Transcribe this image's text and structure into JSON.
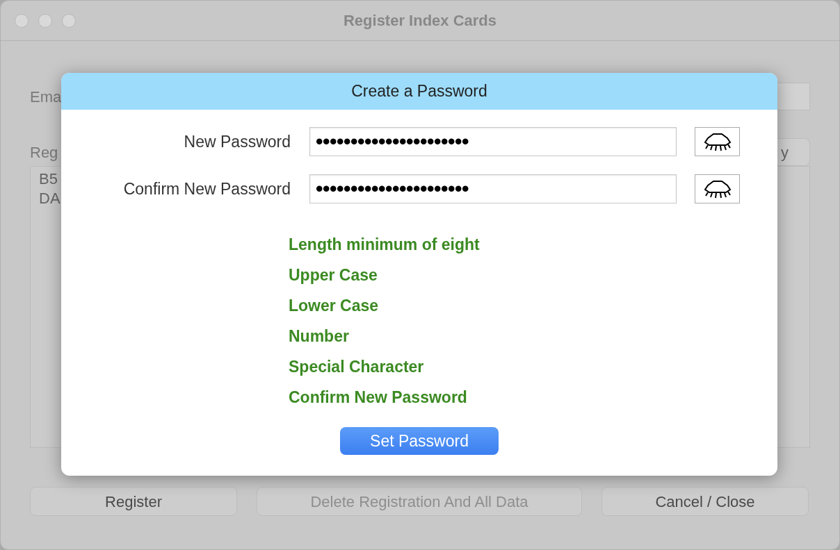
{
  "window": {
    "title": "Register Index Cards"
  },
  "background": {
    "email_label": "Ema",
    "registration_label": "Reg",
    "side_button": "y",
    "list_items": [
      "B5",
      "DA"
    ],
    "buttons": [
      {
        "label": "Register",
        "disabled": false
      },
      {
        "label": "Delete Registration And All Data",
        "disabled": true
      },
      {
        "label": "Cancel / Close",
        "disabled": false
      }
    ]
  },
  "dialog": {
    "title": "Create a Password",
    "fields": [
      {
        "label": "New Password",
        "value": "••••••••••••••••••••••"
      },
      {
        "label": "Confirm New Password",
        "value": "••••••••••••••••••••••"
      }
    ],
    "requirements": [
      {
        "text": "Length minimum of eight",
        "met": true
      },
      {
        "text": "Upper Case",
        "met": true
      },
      {
        "text": "Lower Case",
        "met": true
      },
      {
        "text": "Number",
        "met": true
      },
      {
        "text": "Special Character",
        "met": true
      },
      {
        "text": "Confirm New Password",
        "met": true
      }
    ],
    "button": "Set Password"
  }
}
